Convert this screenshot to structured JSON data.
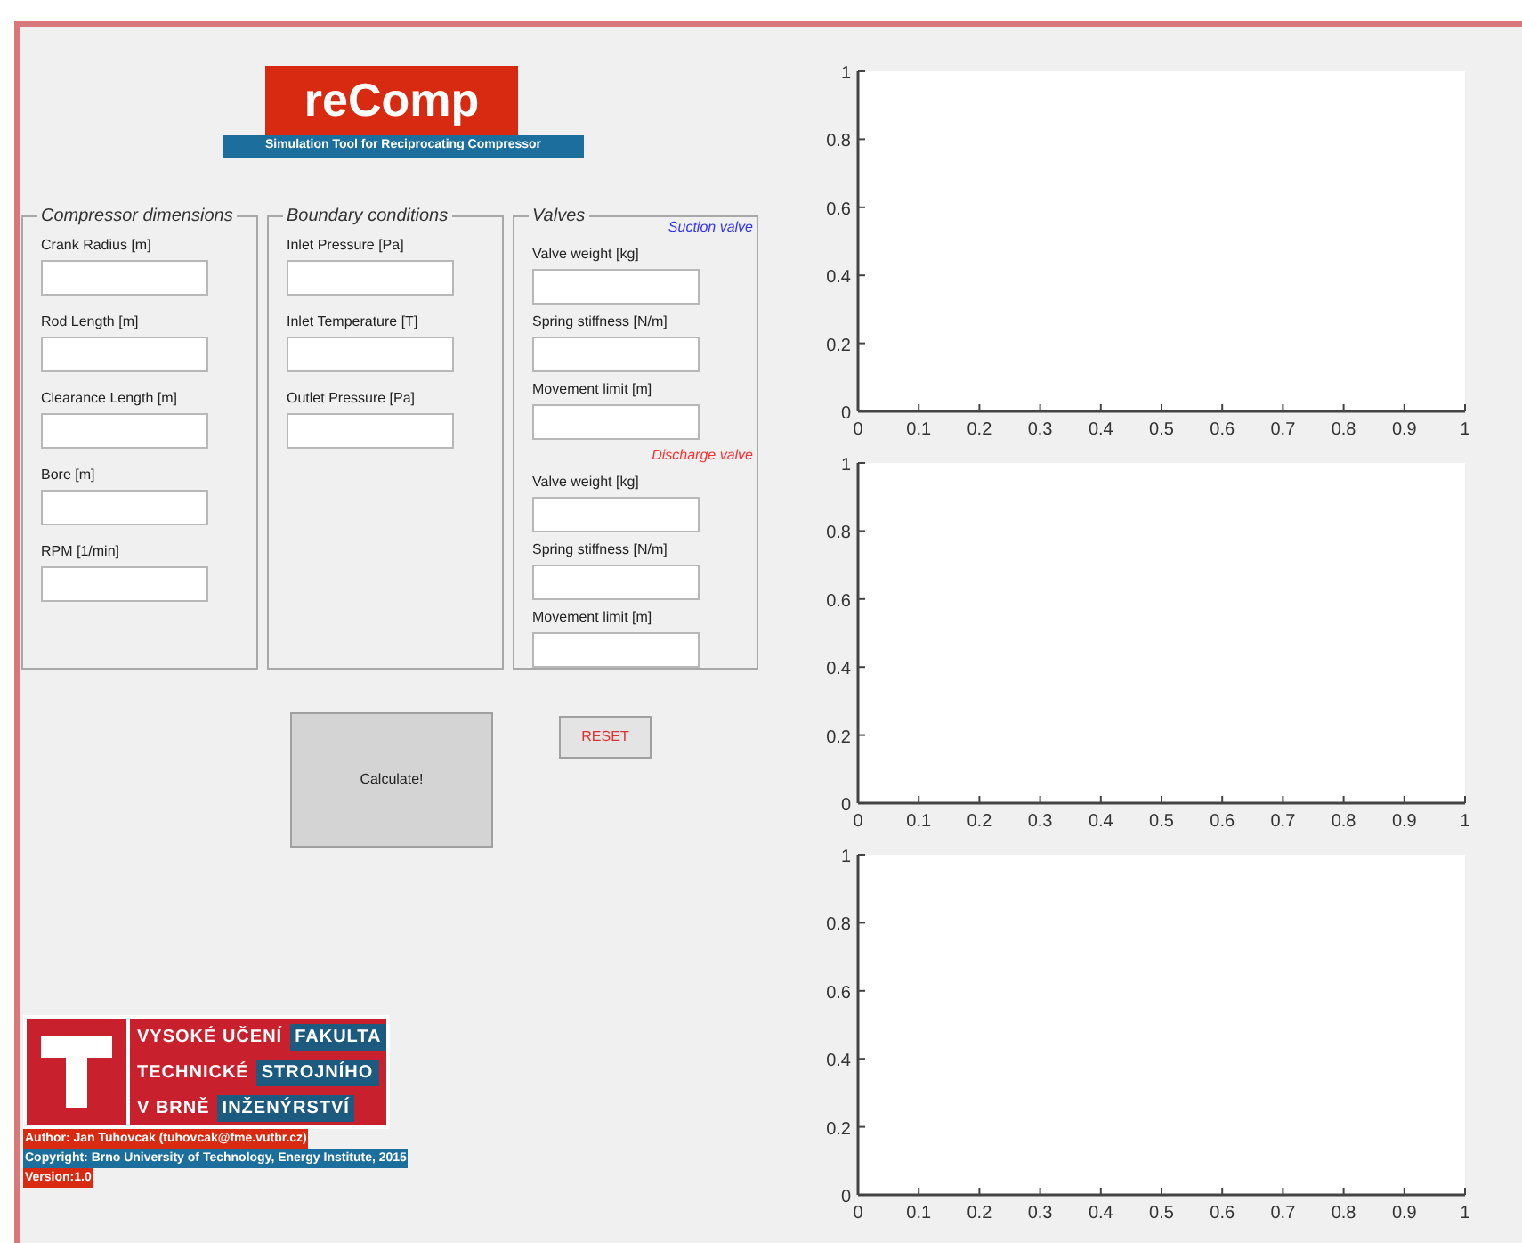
{
  "logo": {
    "title": "reComp",
    "subtitle": "Simulation Tool for Reciprocating Compressor"
  },
  "groups": [
    {
      "title": "Compressor dimensions",
      "sections": [
        {
          "fields": [
            {
              "label": "Crank Radius [m]"
            },
            {
              "label": "Rod Length [m]"
            },
            {
              "label": "Clearance Length [m]"
            },
            {
              "label": "Bore [m]"
            },
            {
              "label": "RPM [1/min]"
            }
          ]
        }
      ]
    },
    {
      "title": "Boundary conditions",
      "sections": [
        {
          "fields": [
            {
              "label": "Inlet Pressure [Pa]"
            },
            {
              "label": "Inlet Temperature [T]"
            },
            {
              "label": "Outlet Pressure [Pa]"
            }
          ]
        }
      ]
    },
    {
      "title": "Valves",
      "sections": [
        {
          "title": "Suction valve",
          "color": "#3333ff",
          "fields": [
            {
              "label": "Valve weight [kg]"
            },
            {
              "label": "Spring stiffness [N/m]"
            },
            {
              "label": "Movement limit [m]"
            }
          ]
        },
        {
          "title": "Discharge valve",
          "color": "#ff3030",
          "fields": [
            {
              "label": "Valve weight [kg]"
            },
            {
              "label": "Spring stiffness [N/m]"
            },
            {
              "label": "Movement limit [m]"
            }
          ]
        }
      ]
    }
  ],
  "buttons": [
    {
      "label": "Calculate!",
      "kind": "primary"
    },
    {
      "label": "RESET",
      "kind": "reset"
    }
  ],
  "university": {
    "rows": [
      {
        "left": "VYSOKÉ UČENÍ",
        "right": "FAKULTA"
      },
      {
        "left": "TECHNICKÉ",
        "right": "STROJNÍHO"
      },
      {
        "left": "V BRNĚ",
        "right": "INŽENÝRSTVÍ"
      }
    ]
  },
  "credits": [
    {
      "text": "Author: Jan Tuhovcak (tuhovcak@fme.vutbr.cz)",
      "color": "#d82a10"
    },
    {
      "text": "Copyright: Brno University of Technology, Energy Institute, 2015",
      "color": "#1c6f9c"
    },
    {
      "text": "Version:1.0",
      "color": "#d82a10"
    }
  ],
  "charts": [
    {
      "chart_data": {
        "type": "line",
        "xlim": [
          0,
          1
        ],
        "ylim": [
          0,
          1
        ],
        "xticks": [
          0,
          0.1,
          0.2,
          0.3,
          0.4,
          0.5,
          0.6,
          0.7,
          0.8,
          0.9,
          1
        ],
        "yticks": [
          0,
          0.2,
          0.4,
          0.6,
          0.8,
          1
        ]
      }
    },
    {
      "chart_data": {
        "type": "line",
        "xlim": [
          0,
          1
        ],
        "ylim": [
          0,
          1
        ],
        "xticks": [
          0,
          0.1,
          0.2,
          0.3,
          0.4,
          0.5,
          0.6,
          0.7,
          0.8,
          0.9,
          1
        ],
        "yticks": [
          0,
          0.2,
          0.4,
          0.6,
          0.8,
          1
        ]
      }
    },
    {
      "chart_data": {
        "type": "line",
        "xlim": [
          0,
          1
        ],
        "ylim": [
          0,
          1
        ],
        "xticks": [
          0,
          0.1,
          0.2,
          0.3,
          0.4,
          0.5,
          0.6,
          0.7,
          0.8,
          0.9,
          1
        ],
        "yticks": [
          0,
          0.2,
          0.4,
          0.6,
          0.8,
          1
        ]
      }
    }
  ]
}
